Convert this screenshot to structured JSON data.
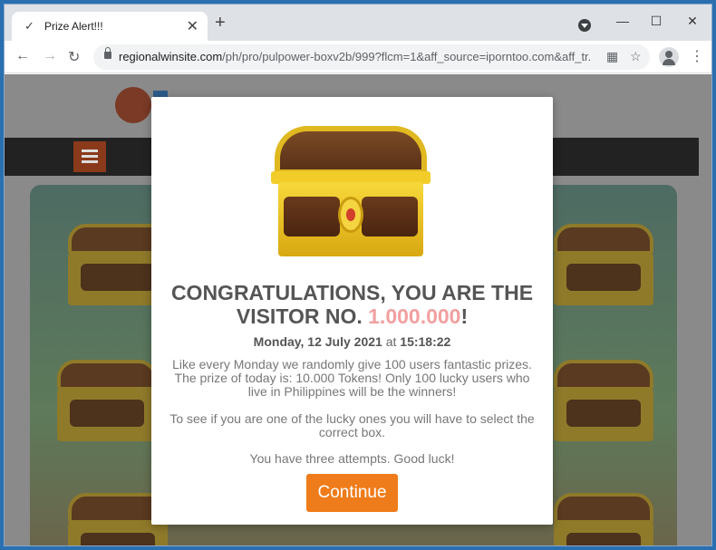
{
  "browser": {
    "tab": {
      "title": "Prize Alert!!!",
      "favicon": "check-icon",
      "close": "✕"
    },
    "new_tab": "+",
    "window_buttons": {
      "minimize": "—",
      "maximize": "☐",
      "close": "✕"
    },
    "url": {
      "host": "regionalwinsite.com",
      "path": "/ph/pro/pulpower-boxv2b/999?flcm=1&aff_source=iporntoo.com&aff_tr..."
    },
    "nav": {
      "back": "←",
      "forward": "→",
      "reload": "↻"
    },
    "icons": {
      "apps": "▦",
      "star": "☆",
      "menu": "⋮"
    }
  },
  "modal": {
    "headline_line1": "CONGRATULATIONS, YOU ARE THE",
    "headline_prefix": "VISITOR NO. ",
    "visitor_number": "1.000.000",
    "headline_suffix": "!",
    "date": "Monday, 12 July 2021",
    "at": " at ",
    "time": "15:18:22",
    "para1": "Like every Monday we randomly give 100 users fantastic prizes. The prize of today is: 10.000 Tokens! Only 100 lucky users who live in Philippines will be the winners!",
    "para2": "To see if you are one of the lucky ones you will have to select the correct box.",
    "para3": "You have three attempts. Good luck!",
    "button": "Continue"
  },
  "colors": {
    "accent": "#ef7c1a",
    "number": "#f2a0a0",
    "heading": "#555555"
  }
}
